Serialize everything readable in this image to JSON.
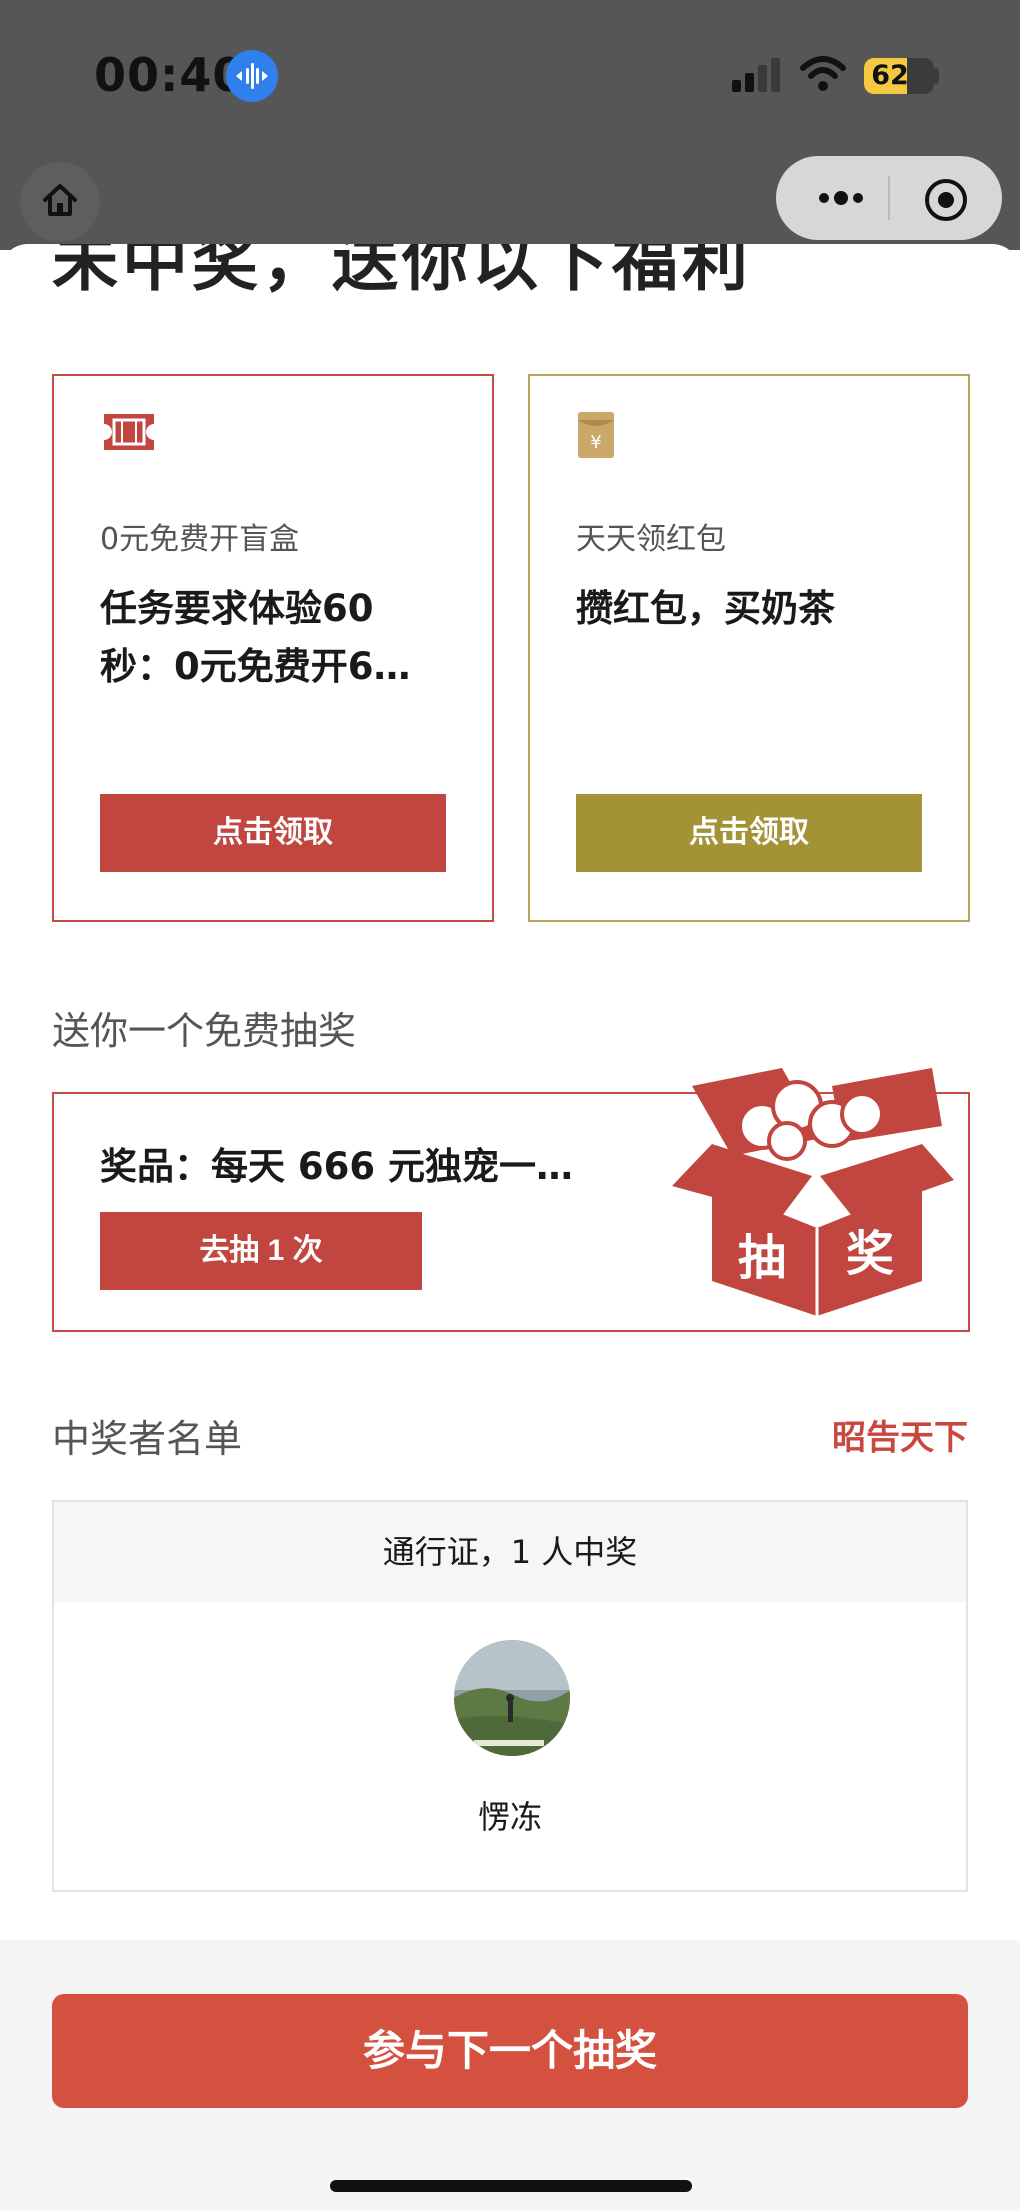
{
  "status_bar": {
    "time": "00:40",
    "battery": "62",
    "battery_level": 0.62
  },
  "header": {
    "partial_title": "未中奖，送你以下福利"
  },
  "cards": [
    {
      "kicker": "0元免费开盲盒",
      "description": "任务要求体验60秒：0元免费开6…",
      "button": "点击领取",
      "accent": "#c0463f"
    },
    {
      "kicker": "天天领红包",
      "description": "攒红包，买奶茶",
      "button": "点击领取",
      "accent": "#a49336"
    }
  ],
  "lottery": {
    "title": "送你一个免费抽奖",
    "prize": "奖品：每天 666 元独宠一…",
    "button": "去抽 1 次",
    "box_chars": [
      "抽",
      "奖"
    ]
  },
  "winners": {
    "title": "中奖者名单",
    "link": "昭告天下",
    "summary": "通行证，1 人中奖",
    "names": [
      "愣冻"
    ]
  },
  "footer": {
    "button": "参与下一个抽奖"
  },
  "colors": {
    "red": "#c0463f",
    "gold": "#a49336",
    "link_red": "#c8483f",
    "primary": "#d4503f"
  },
  "icons": [
    "voice-icon",
    "signal-icon",
    "wifi-icon",
    "battery-icon",
    "home-icon",
    "more-icon",
    "target-icon",
    "ticket-icon",
    "red-envelope-icon",
    "gift-box-icon"
  ]
}
